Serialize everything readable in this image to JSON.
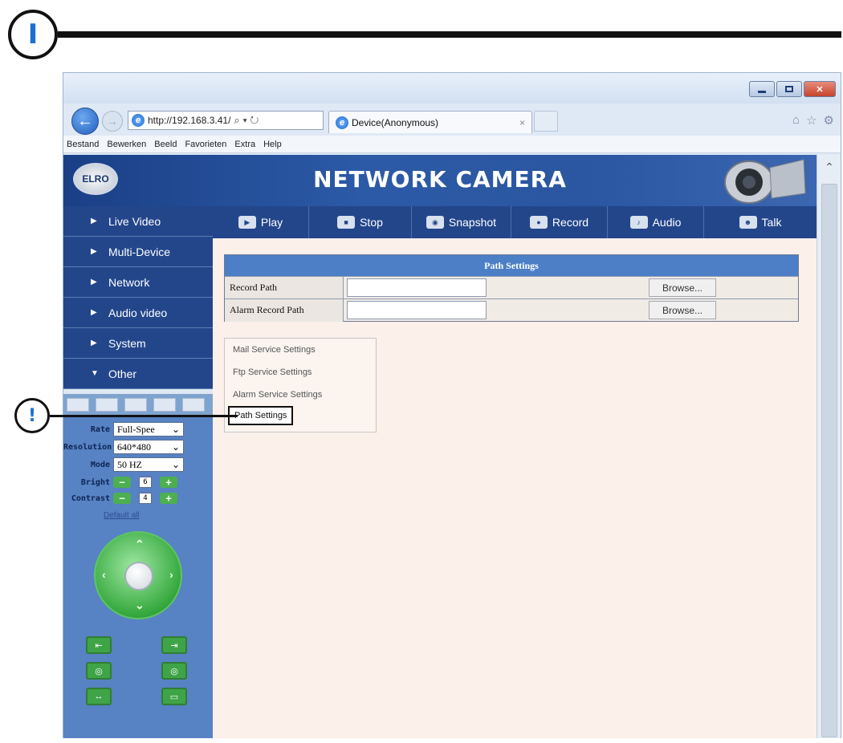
{
  "manual": {
    "marker": "I",
    "callout": "!"
  },
  "browser": {
    "address": "http://192.168.3.41/",
    "address_controls": "⌕ ▾ ↻",
    "tab_title": "Device(Anonymous)",
    "tab_close": "×",
    "menu": [
      "Bestand",
      "Bewerken",
      "Beeld",
      "Favorieten",
      "Extra",
      "Help"
    ],
    "right_icons": [
      "⌂",
      "☆",
      "⚙"
    ]
  },
  "app": {
    "logo": "ELRO",
    "title": "NETWORK CAMERA"
  },
  "sidebar": {
    "items": [
      {
        "label": "Live Video",
        "arrow": "▶"
      },
      {
        "label": "Multi-Device",
        "arrow": "▶"
      },
      {
        "label": "Network",
        "arrow": "▶"
      },
      {
        "label": "Audio video",
        "arrow": "▶"
      },
      {
        "label": "System",
        "arrow": "▶"
      },
      {
        "label": "Other",
        "arrow": "▼"
      }
    ]
  },
  "params": {
    "rate_label": "Rate",
    "rate_value": "Full-Spee",
    "resolution_label": "Resolution",
    "resolution_value": "640*480",
    "mode_label": "Mode",
    "mode_value": "50 HZ",
    "bright_label": "Bright",
    "bright_value": "6",
    "contrast_label": "Contrast",
    "contrast_value": "4",
    "minus": "−",
    "plus": "+",
    "default_all": "Default all"
  },
  "toolbar": {
    "items": [
      {
        "label": "Play",
        "icon": "play-icon"
      },
      {
        "label": "Stop",
        "icon": "stop-icon"
      },
      {
        "label": "Snapshot",
        "icon": "snapshot-icon"
      },
      {
        "label": "Record",
        "icon": "record-icon"
      },
      {
        "label": "Audio",
        "icon": "audio-icon"
      },
      {
        "label": "Talk",
        "icon": "talk-icon"
      }
    ]
  },
  "path_settings": {
    "header": "Path Settings",
    "rows": [
      {
        "label": "Record Path",
        "value": "",
        "button": "Browse..."
      },
      {
        "label": "Alarm Record Path",
        "value": "",
        "button": "Browse..."
      }
    ]
  },
  "submenu": {
    "items": [
      "Mail Service Settings",
      "Ftp Service Settings",
      "Alarm Service Settings",
      "Path Settings"
    ],
    "active": "Path Settings"
  }
}
